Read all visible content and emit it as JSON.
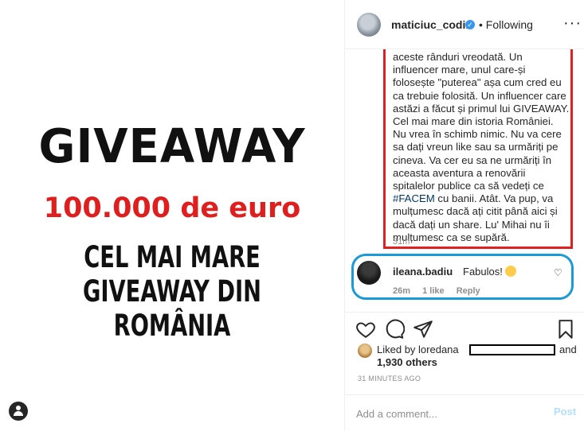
{
  "image": {
    "title": "GIVEAWAY",
    "subtitle": "100.000 de euro",
    "line1": "CEL MAI MARE",
    "line2": "GIVEAWAY DIN ROMÂNIA",
    "tag_icon": "user-tag-icon"
  },
  "header": {
    "username": "maticiuc_codin",
    "verified_icon": "verified-badge-icon",
    "following": "• Following",
    "more_icon": "more-options-icon",
    "more_glyph": "···"
  },
  "caption": {
    "text_before": "aceste rânduri vreodată. Un influencer mare, unul care-și folosește \"puterea\" așa cum cred eu ca trebuie folosită. Un influencer care astăzi a făcut și primul lui GIVEAWAY. Cel mai mare din istoria României. Nu vrea în schimb nimic. Nu va cere sa dați vreun like sau sa urmăriți pe cineva. Va cer eu sa ne urmăriți în aceasta aventura a renovării spitalelor publice ca să vedeți ce ",
    "hashtag": "#FACEM",
    "text_after": " cu banii. Atât. Va pup, va mulțumesc dacă ați citit până aici și dacă dați un share. Lu' Mihai nu îi mulțumesc ca se supără.",
    "time": "31m"
  },
  "comment": {
    "user": "ileana.badiu",
    "text": "Fabulos!",
    "emoji_icon": "smiling-face-icon",
    "time": "26m",
    "likes": "1 like",
    "reply": "Reply",
    "heart_glyph": "♡"
  },
  "actions": {
    "like_icon": "heart-icon",
    "comment_icon": "comment-icon",
    "share_icon": "share-icon",
    "save_icon": "bookmark-icon"
  },
  "likes": {
    "liked_by": "Liked by loredana",
    "and": "and",
    "others": "1,930 others"
  },
  "timestamp": "31 MINUTES AGO",
  "add_comment": {
    "placeholder": "Add a comment...",
    "post": "Post"
  },
  "colors": {
    "annotation_red": "#e02020",
    "annotation_blue": "#1a9bd7",
    "verified_blue": "#3897f0",
    "euro_red": "#e01e1e"
  }
}
